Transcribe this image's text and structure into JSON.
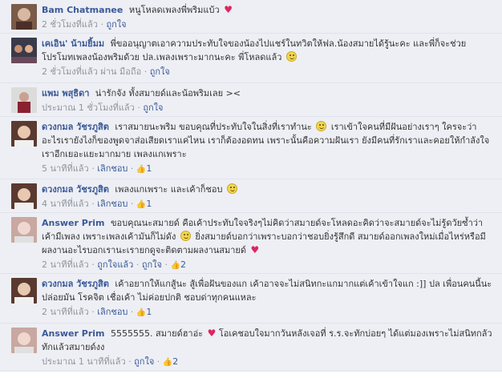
{
  "comments": [
    {
      "name": "Bam Chatmanee",
      "text": "หนูโหลดเพลงพี่พริมแบ้ว",
      "emoji": "heart",
      "time": "2 ชั่วโมงที่แล้ว",
      "like_label": "ถูกใจ",
      "avatar_colors": [
        "#7a5a48",
        "#d8b8a0"
      ]
    },
    {
      "name": "เคเอิน' น้ามยิ้มม",
      "text": "พี่ขออนุญาตเอาความประทับใจของน้องไปแชร์ในทวิตให้ฟล.น้องสมายได้รู้นะคะ และพี่ก็จะช่วยโปรโมทเพลงน้องพริมด้วย ปล.เพลงเพราะมากนะคะ พี่โหลดแล้ว",
      "emoji": "smiley",
      "time": "2 ชั่วโมงที่แล้ว ผ่าน มือถือ",
      "like_label": "ถูกใจ",
      "avatar_colors": [
        "#3a3a4a",
        "#c89070"
      ]
    },
    {
      "name": "แพม พสุธิดา",
      "text": "น่ารักจัง ทั้งสมายด์และน้อพริมเลย ><",
      "emoji": "",
      "time": "ประมาณ 1 ชั่วโมงที่แล้ว",
      "like_label": "ถูกใจ",
      "avatar_colors": [
        "#dcdcdc",
        "#8a2030"
      ]
    },
    {
      "name": "ดวงกมล วัชรภูสิต",
      "text": "เราสมายนะพริม ขอบคุณที่ประทับใจในสิ่งที่เราทำนะ",
      "emoji": "smiley",
      "text2": "เราเข้าใจคนที่มีฝันอย่างเราๆ ใครจะว่าอะไรเรายังไงก็ของพูดจาส่อเสียดเราแค่ไหน เราก็ต้องอดทน เพราะนั้นคือความฝันเรา ยังมีคนที่รักเราและคอยให้กำลังใจเราอีกเยอะแยะมากมาย เพลงแกเพราะ",
      "time": "5 นาทีที่แล้ว",
      "like_label": "เลิกชอบ",
      "likes": "1",
      "avatar_colors": [
        "#5a3a30",
        "#e8c8b0"
      ]
    },
    {
      "name": "ดวงกมล วัชรภูสิต",
      "text": "เพลงแกเพราะ และเค้าก็ชอบ",
      "emoji": "smiley",
      "time": "4 นาทีที่แล้ว",
      "like_label": "เลิกชอบ",
      "likes": "1",
      "avatar_colors": [
        "#5a3a30",
        "#e8c8b0"
      ]
    },
    {
      "name": "Answer Prim",
      "text": "ขอบคุณนะสมายด์ คือเค้าประทับใจจริงๆไม่คิดว่าสมายด์จะโหลดอะคิดว่าจะสมายด์จะไม่รู้ดวัยซ้ำว่าเค้ามีเพลง เพราะเพลงเค้ามันก็ไม่ดัง",
      "emoji": "smiley",
      "text2": "ยิ่งสมายด์บอกว่าเพราะบอกว่าชอบยิ่งรู้สึกดี สมายด์ออกเพลงใหม่เมื่อไหร่หรือมีผลงานอะไรบอกเรานะเรายกดูจะติดตามผลงานสมายด์",
      "emoji2": "heart",
      "time": "2 นาทีที่แล้ว",
      "unlike_label": "ถูกใจแล้ว",
      "like_label": "ถูกใจ",
      "likes": "2",
      "avatar_colors": [
        "#c8a8a0",
        "#f0d8d0"
      ]
    },
    {
      "name": "ดวงกมล วัชรภูสิต",
      "text": "เค้าอยากให้แกสู้นะ สู้เพื่อฝันของแก เค้าอาจจะไม่สนิทกะแกมากแต่เค้าเข้าใจแก :]] ปล เพื่อนคนนี้นะ ปล่อยมัน โรคจิต เชื่อเค้า ไม่ค่อยปกติ ชอบด่าทุกคนแหละ",
      "emoji": "",
      "time": "2 นาทีที่แล้ว",
      "like_label": "เลิกชอบ",
      "likes": "1",
      "avatar_colors": [
        "#5a3a30",
        "#e8c8b0"
      ]
    },
    {
      "name": "Answer Prim",
      "text": "5555555. สมายด์ฮาอ่ะ",
      "emoji": "heart",
      "text2": "โอเคชอบใจมากวันหลังเจอที่ ร.ร.จะทักบ่อยๆ ได้แต่มองเพราะไม่สนิทกลัวทักแล้วสมายด์งง",
      "time": "ประมาณ 1 นาทีที่แล้ว",
      "like_label": "ถูกใจ",
      "likes": "2",
      "avatar_colors": [
        "#c8a8a0",
        "#f0d8d0"
      ]
    }
  ]
}
